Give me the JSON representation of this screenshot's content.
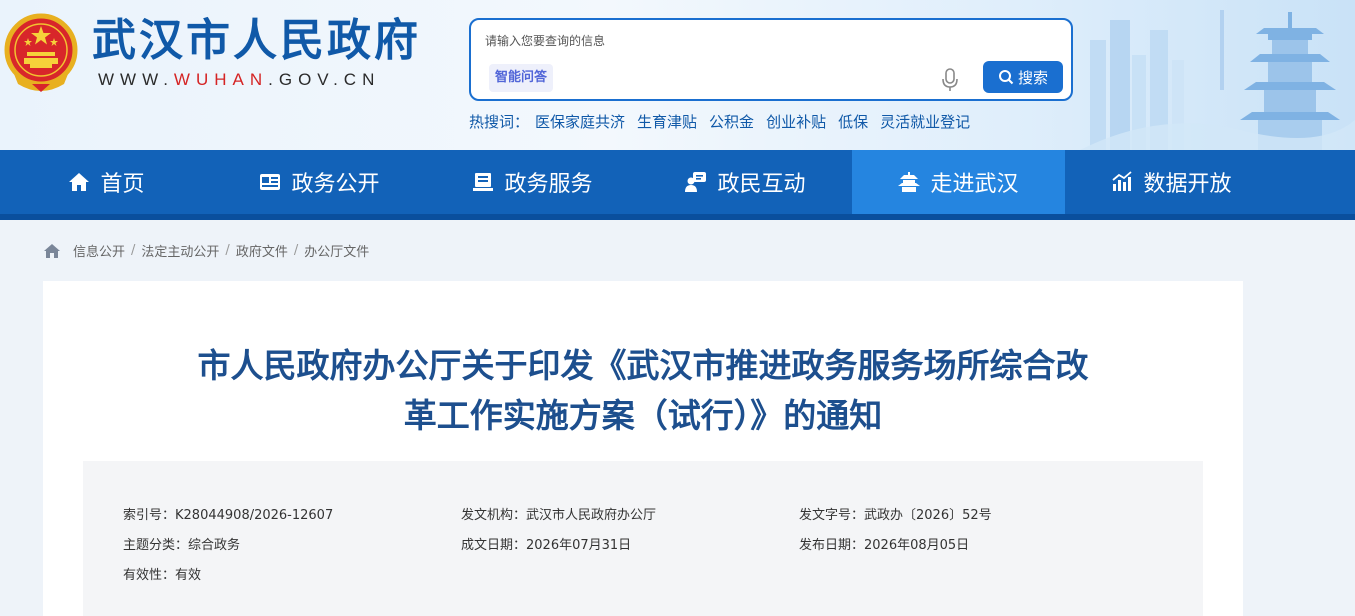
{
  "site": {
    "title": "武汉市人民政府",
    "url_prefix": "WWW.",
    "url_highlight": "WUHAN",
    "url_suffix": ".GOV.CN"
  },
  "search": {
    "placeholder": "请输入您要查询的信息",
    "ai_label": "智能问答",
    "button_label": "搜索"
  },
  "hot": {
    "label": "热搜词：",
    "terms": [
      "医保家庭共济",
      "生育津贴",
      "公积金",
      "创业补贴",
      "低保",
      "灵活就业登记"
    ]
  },
  "nav": {
    "items": [
      {
        "label": "首页",
        "icon": "home-icon"
      },
      {
        "label": "政务公开",
        "icon": "news-icon"
      },
      {
        "label": "政务服务",
        "icon": "service-icon"
      },
      {
        "label": "政民互动",
        "icon": "chat-icon"
      },
      {
        "label": "走进武汉",
        "icon": "pavilion-icon"
      },
      {
        "label": "数据开放",
        "icon": "chart-icon"
      }
    ],
    "active_index": 4
  },
  "breadcrumb": [
    "信息公开",
    "法定主动公开",
    "政府文件",
    "办公厅文件"
  ],
  "document": {
    "title_line1": "市人民政府办公厅关于印发《武汉市推进政务服务场所综合改",
    "title_line2": "革工作实施方案（试行）》的通知",
    "meta": {
      "index_label": "索引号：",
      "index_value": "K28044908/2026-12607",
      "issuer_label": "发文机构：",
      "issuer_value": "武汉市人民政府办公厅",
      "docno_label": "发文字号：",
      "docno_value": "武政办〔2026〕52号",
      "topic_label": "主题分类：",
      "topic_value": "综合政务",
      "created_label": "成文日期：",
      "created_value": "2026年07月31日",
      "published_label": "发布日期：",
      "published_value": "2026年08月05日",
      "validity_label": "有效性：",
      "validity_value": "有效"
    }
  },
  "colors": {
    "brand": "#1059a8",
    "nav": "#1262b8",
    "nav_active": "#2585e0",
    "url_highlight": "#d52424"
  }
}
